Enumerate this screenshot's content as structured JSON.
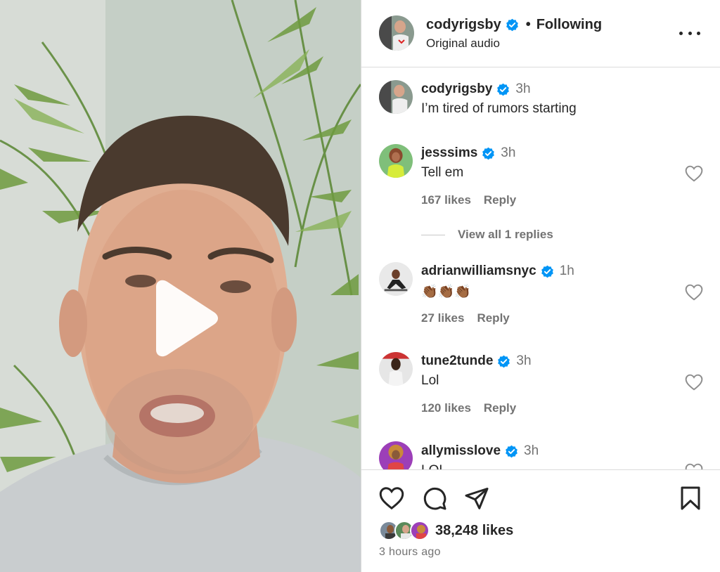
{
  "post": {
    "username": "codyrigsby",
    "separator": "•",
    "follow_status": "Following",
    "audio": "Original audio"
  },
  "comments": [
    {
      "username": "codyrigsby",
      "time": "3h",
      "text": "I’m tired of rumors starting"
    },
    {
      "username": "jesssims",
      "time": "3h",
      "text": "Tell em",
      "likes": "167 likes",
      "reply": "Reply"
    },
    {
      "username": "adrianwilliamsnyc",
      "time": "1h",
      "text": "👏🏾👏🏾👏🏾",
      "likes": "27 likes",
      "reply": "Reply"
    },
    {
      "username": "tune2tunde",
      "time": "3h",
      "text": "Lol",
      "likes": "120 likes",
      "reply": "Reply"
    },
    {
      "username": "allymisslove",
      "time": "3h",
      "text": "LOL"
    }
  ],
  "view_replies": "View all 1 replies",
  "engagement": {
    "likes": "38,248 likes",
    "posted": "3 hours ago"
  },
  "icons": [
    "play-icon",
    "verified-icon",
    "more-icon",
    "heart-icon",
    "comment-icon",
    "share-icon",
    "bookmark-icon"
  ],
  "colors": {
    "verified": "#0095f6",
    "text": "#262626",
    "secondary": "#737373",
    "border": "#dbdbdb"
  }
}
